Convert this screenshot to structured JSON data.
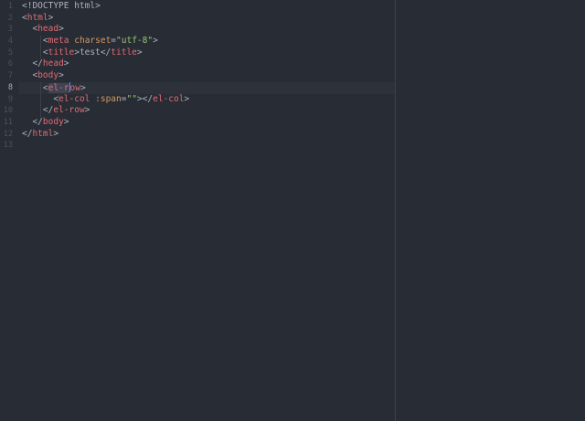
{
  "editor": {
    "active_line": 8,
    "cursor": {
      "line": 8,
      "column": 8
    }
  },
  "gutter": {
    "line_numbers": [
      "1",
      "2",
      "3",
      "4",
      "5",
      "6",
      "7",
      "8",
      "9",
      "10",
      "11",
      "12",
      "13"
    ]
  },
  "code": {
    "lines": [
      {
        "indent": 0,
        "tokens": [
          {
            "t": "doctype",
            "v": "<!DOCTYPE html>"
          }
        ]
      },
      {
        "indent": 0,
        "tokens": [
          {
            "t": "punct",
            "v": "<"
          },
          {
            "t": "tag",
            "v": "html"
          },
          {
            "t": "punct",
            "v": ">"
          }
        ]
      },
      {
        "indent": 1,
        "tokens": [
          {
            "t": "punct",
            "v": "<"
          },
          {
            "t": "tag",
            "v": "head"
          },
          {
            "t": "punct",
            "v": ">"
          }
        ]
      },
      {
        "indent": 2,
        "tokens": [
          {
            "t": "punct",
            "v": "<"
          },
          {
            "t": "tag",
            "v": "meta"
          },
          {
            "t": "punct",
            "v": " "
          },
          {
            "t": "attr",
            "v": "charset"
          },
          {
            "t": "punct",
            "v": "="
          },
          {
            "t": "str",
            "v": "\"utf-8\""
          },
          {
            "t": "punct",
            "v": ">"
          }
        ]
      },
      {
        "indent": 2,
        "tokens": [
          {
            "t": "punct",
            "v": "<"
          },
          {
            "t": "tag",
            "v": "title"
          },
          {
            "t": "punct",
            "v": ">test</"
          },
          {
            "t": "tag",
            "v": "title"
          },
          {
            "t": "punct",
            "v": ">"
          }
        ]
      },
      {
        "indent": 1,
        "tokens": [
          {
            "t": "punct",
            "v": "</"
          },
          {
            "t": "tag",
            "v": "head"
          },
          {
            "t": "punct",
            "v": ">"
          }
        ]
      },
      {
        "indent": 1,
        "tokens": [
          {
            "t": "punct",
            "v": "<"
          },
          {
            "t": "tag",
            "v": "body"
          },
          {
            "t": "punct",
            "v": ">"
          }
        ]
      },
      {
        "indent": 2,
        "tokens": [
          {
            "t": "punct",
            "v": "<"
          },
          {
            "t": "tag sel",
            "v": "el-r"
          },
          {
            "t": "caret",
            "v": ""
          },
          {
            "t": "tag",
            "v": "ow"
          },
          {
            "t": "punct",
            "v": ">"
          }
        ]
      },
      {
        "indent": 3,
        "tokens": [
          {
            "t": "punct",
            "v": "<"
          },
          {
            "t": "tag",
            "v": "el-col"
          },
          {
            "t": "punct",
            "v": " "
          },
          {
            "t": "attr",
            "v": ":span"
          },
          {
            "t": "punct",
            "v": "="
          },
          {
            "t": "str",
            "v": "\"\""
          },
          {
            "t": "punct",
            "v": "></"
          },
          {
            "t": "tag",
            "v": "el-col"
          },
          {
            "t": "punct",
            "v": ">"
          }
        ]
      },
      {
        "indent": 2,
        "tokens": [
          {
            "t": "punct",
            "v": "</"
          },
          {
            "t": "tag",
            "v": "el-row"
          },
          {
            "t": "punct",
            "v": ">"
          }
        ]
      },
      {
        "indent": 1,
        "tokens": [
          {
            "t": "punct",
            "v": "</"
          },
          {
            "t": "tag",
            "v": "body"
          },
          {
            "t": "punct",
            "v": ">"
          }
        ]
      },
      {
        "indent": 0,
        "tokens": [
          {
            "t": "punct",
            "v": "</"
          },
          {
            "t": "tag",
            "v": "html"
          },
          {
            "t": "punct",
            "v": ">"
          }
        ]
      },
      {
        "indent": 0,
        "tokens": []
      }
    ]
  },
  "theme": {
    "background": "#282c34",
    "tag": "#e06c75",
    "attribute": "#d19a66",
    "string": "#98c379",
    "text": "#abb2bf",
    "line_number": "#495162",
    "cursor": "#528bff"
  }
}
